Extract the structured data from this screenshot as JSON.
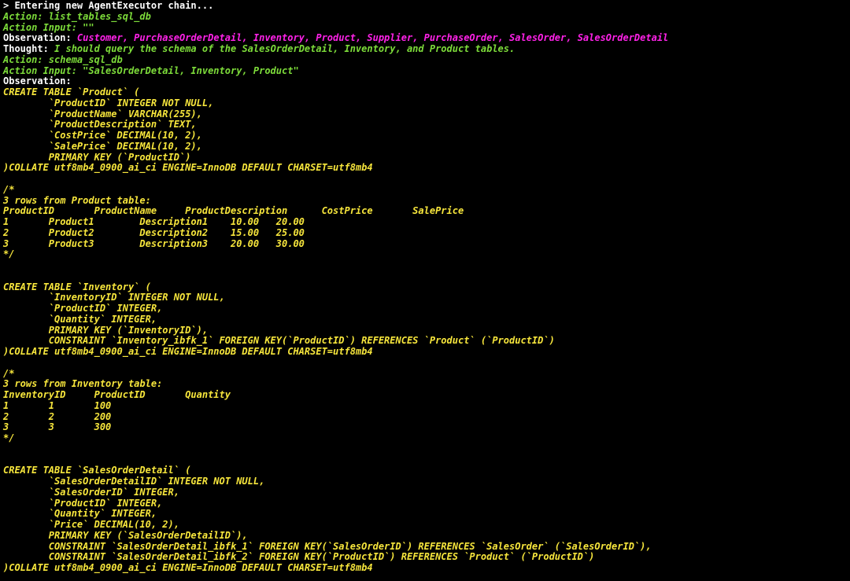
{
  "colors": {
    "background": "#000000",
    "default_text": "#ffffff",
    "action_green": "#7ddc3a",
    "observation_magenta": "#ff22e8",
    "sql_yellow": "#f7e63c"
  },
  "lines": [
    [
      {
        "c": "w",
        "t": "> Entering new AgentExecutor chain..."
      }
    ],
    [
      {
        "c": "g",
        "t": "Action: list_tables_sql_db"
      }
    ],
    [
      {
        "c": "g",
        "t": "Action Input: \"\""
      }
    ],
    [
      {
        "c": "w",
        "t": "Observation: "
      },
      {
        "c": "m",
        "t": "Customer, PurchaseOrderDetail, Inventory, Product, Supplier, PurchaseOrder, SalesOrder, SalesOrderDetail"
      }
    ],
    [
      {
        "c": "w",
        "t": "Thought: "
      },
      {
        "c": "g",
        "t": "I should query the schema of the SalesOrderDetail, Inventory, and Product tables."
      }
    ],
    [
      {
        "c": "g",
        "t": "Action: schema_sql_db"
      }
    ],
    [
      {
        "c": "g",
        "t": "Action Input: \"SalesOrderDetail, Inventory, Product\""
      }
    ],
    [
      {
        "c": "w",
        "t": "Observation:"
      }
    ],
    [
      {
        "c": "y",
        "t": "CREATE TABLE `Product` ("
      }
    ],
    [
      {
        "c": "y",
        "t": "        `ProductID` INTEGER NOT NULL,"
      }
    ],
    [
      {
        "c": "y",
        "t": "        `ProductName` VARCHAR(255),"
      }
    ],
    [
      {
        "c": "y",
        "t": "        `ProductDescription` TEXT,"
      }
    ],
    [
      {
        "c": "y",
        "t": "        `CostPrice` DECIMAL(10, 2),"
      }
    ],
    [
      {
        "c": "y",
        "t": "        `SalePrice` DECIMAL(10, 2),"
      }
    ],
    [
      {
        "c": "y",
        "t": "        PRIMARY KEY (`ProductID`)"
      }
    ],
    [
      {
        "c": "y",
        "t": ")COLLATE utf8mb4_0900_ai_ci ENGINE=InnoDB DEFAULT CHARSET=utf8mb4"
      }
    ],
    [
      {
        "c": "y",
        "t": ""
      }
    ],
    [
      {
        "c": "y",
        "t": "/*"
      }
    ],
    [
      {
        "c": "y",
        "t": "3 rows from Product table:"
      }
    ],
    [
      {
        "c": "y",
        "t": "ProductID       ProductName     ProductDescription      CostPrice       SalePrice"
      }
    ],
    [
      {
        "c": "y",
        "t": "1       Product1        Description1    10.00   20.00"
      }
    ],
    [
      {
        "c": "y",
        "t": "2       Product2        Description2    15.00   25.00"
      }
    ],
    [
      {
        "c": "y",
        "t": "3       Product3        Description3    20.00   30.00"
      }
    ],
    [
      {
        "c": "y",
        "t": "*/"
      }
    ],
    [
      {
        "c": "y",
        "t": ""
      }
    ],
    [
      {
        "c": "y",
        "t": ""
      }
    ],
    [
      {
        "c": "y",
        "t": "CREATE TABLE `Inventory` ("
      }
    ],
    [
      {
        "c": "y",
        "t": "        `InventoryID` INTEGER NOT NULL,"
      }
    ],
    [
      {
        "c": "y",
        "t": "        `ProductID` INTEGER,"
      }
    ],
    [
      {
        "c": "y",
        "t": "        `Quantity` INTEGER,"
      }
    ],
    [
      {
        "c": "y",
        "t": "        PRIMARY KEY (`InventoryID`),"
      }
    ],
    [
      {
        "c": "y",
        "t": "        CONSTRAINT `Inventory_ibfk_1` FOREIGN KEY(`ProductID`) REFERENCES `Product` (`ProductID`)"
      }
    ],
    [
      {
        "c": "y",
        "t": ")COLLATE utf8mb4_0900_ai_ci ENGINE=InnoDB DEFAULT CHARSET=utf8mb4"
      }
    ],
    [
      {
        "c": "y",
        "t": ""
      }
    ],
    [
      {
        "c": "y",
        "t": "/*"
      }
    ],
    [
      {
        "c": "y",
        "t": "3 rows from Inventory table:"
      }
    ],
    [
      {
        "c": "y",
        "t": "InventoryID     ProductID       Quantity"
      }
    ],
    [
      {
        "c": "y",
        "t": "1       1       100"
      }
    ],
    [
      {
        "c": "y",
        "t": "2       2       200"
      }
    ],
    [
      {
        "c": "y",
        "t": "3       3       300"
      }
    ],
    [
      {
        "c": "y",
        "t": "*/"
      }
    ],
    [
      {
        "c": "y",
        "t": ""
      }
    ],
    [
      {
        "c": "y",
        "t": ""
      }
    ],
    [
      {
        "c": "y",
        "t": "CREATE TABLE `SalesOrderDetail` ("
      }
    ],
    [
      {
        "c": "y",
        "t": "        `SalesOrderDetailID` INTEGER NOT NULL,"
      }
    ],
    [
      {
        "c": "y",
        "t": "        `SalesOrderID` INTEGER,"
      }
    ],
    [
      {
        "c": "y",
        "t": "        `ProductID` INTEGER,"
      }
    ],
    [
      {
        "c": "y",
        "t": "        `Quantity` INTEGER,"
      }
    ],
    [
      {
        "c": "y",
        "t": "        `Price` DECIMAL(10, 2),"
      }
    ],
    [
      {
        "c": "y",
        "t": "        PRIMARY KEY (`SalesOrderDetailID`),"
      }
    ],
    [
      {
        "c": "y",
        "t": "        CONSTRAINT `SalesOrderDetail_ibfk_1` FOREIGN KEY(`SalesOrderID`) REFERENCES `SalesOrder` (`SalesOrderID`),"
      }
    ],
    [
      {
        "c": "y",
        "t": "        CONSTRAINT `SalesOrderDetail_ibfk_2` FOREIGN KEY(`ProductID`) REFERENCES `Product` (`ProductID`)"
      }
    ],
    [
      {
        "c": "y",
        "t": ")COLLATE utf8mb4_0900_ai_ci ENGINE=InnoDB DEFAULT CHARSET=utf8mb4"
      }
    ]
  ]
}
